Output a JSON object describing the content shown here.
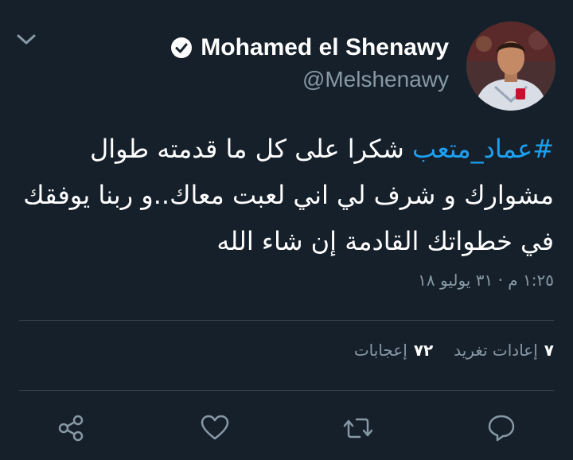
{
  "profile": {
    "display_name": "Mohamed el Shenawy",
    "handle": "@Melshenawy",
    "verified": true
  },
  "tweet": {
    "hashtag": "#عماد_متعب",
    "text": " شكرا على كل ما قدمته طوال مشوارك و شرف لي اني لعبت معاك..و ربنا يوفقك في خطواتك القادمة إن شاء الله",
    "timestamp": "١:٢٥ م · ٣١ يوليو ١٨"
  },
  "stats": {
    "retweets_count": "٧",
    "retweets_label": "إعادات تغريد",
    "likes_count": "٧٢",
    "likes_label": "إعجابات"
  },
  "actions": [
    "reply-icon",
    "retweet-icon",
    "like-icon",
    "share-icon"
  ],
  "colors": {
    "background": "#15202b",
    "secondary_text": "#8899a6",
    "accent": "#1da1f2",
    "divider": "#38444d"
  }
}
